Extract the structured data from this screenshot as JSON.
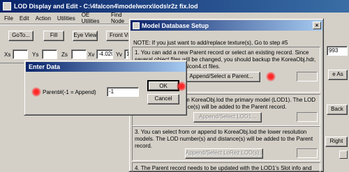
{
  "main_window": {
    "title": "LOD Display and Edit - C:\\4falcon4\\modelworx\\lods\\r2z fix.lod",
    "menu": [
      "File",
      "Edit",
      "Action",
      "Utilities",
      "OE Utilities",
      "Find Node"
    ],
    "buttons": {
      "goto": "GoTo...",
      "fill": "Fill",
      "eye_view": "Eye View",
      "front_view": "Front Vi"
    },
    "coords": {
      "xs_label": "Xs",
      "ys_label": "Ys",
      "zs_label": "Zs",
      "xv_label": "Xv",
      "xv_value": "-4.020",
      "yv_label": "Yv",
      "yv_value": "1.82"
    }
  },
  "model_db": {
    "title": "Model Database Setup",
    "note": "NOTE:  If you just want to add/replace texture(s), Go to step #5",
    "step1": "1. You can add a new Parent record or select an existing record.  Since several object files will be changed, you should backup the KoreaObj.hdr, KoreaObj.lod, and Falcon4.ct  files.",
    "append_parent_button": "Append/Select a Parent...",
    "step2": "2. You can select from KoreaObj.lod the primary model (LOD1). The LOD number(s) and distance(s) will be added to the Parent record.",
    "append_lod1_button": "Append/Select LOD1...",
    "step3": "3. You can select from or append  to KoreaObj.lod the lower resolution models.  The LOD number(s) and distance(s) will be added to the Parent record.",
    "append_lorez_button": "Append/Select LoRez LOD(s)...",
    "step4": "4. The Parent record needs to be updated with the LOD1's Slot info and"
  },
  "enter_data": {
    "title": "Enter Data",
    "field_label": "Parent#(-1 = Append)",
    "field_value": "-1",
    "ok_label": "OK",
    "cancel_label": "Cancel"
  },
  "right_panel": {
    "field_value": "993",
    "button_label": "e As",
    "back_label": "Back",
    "right_label": "Right"
  }
}
